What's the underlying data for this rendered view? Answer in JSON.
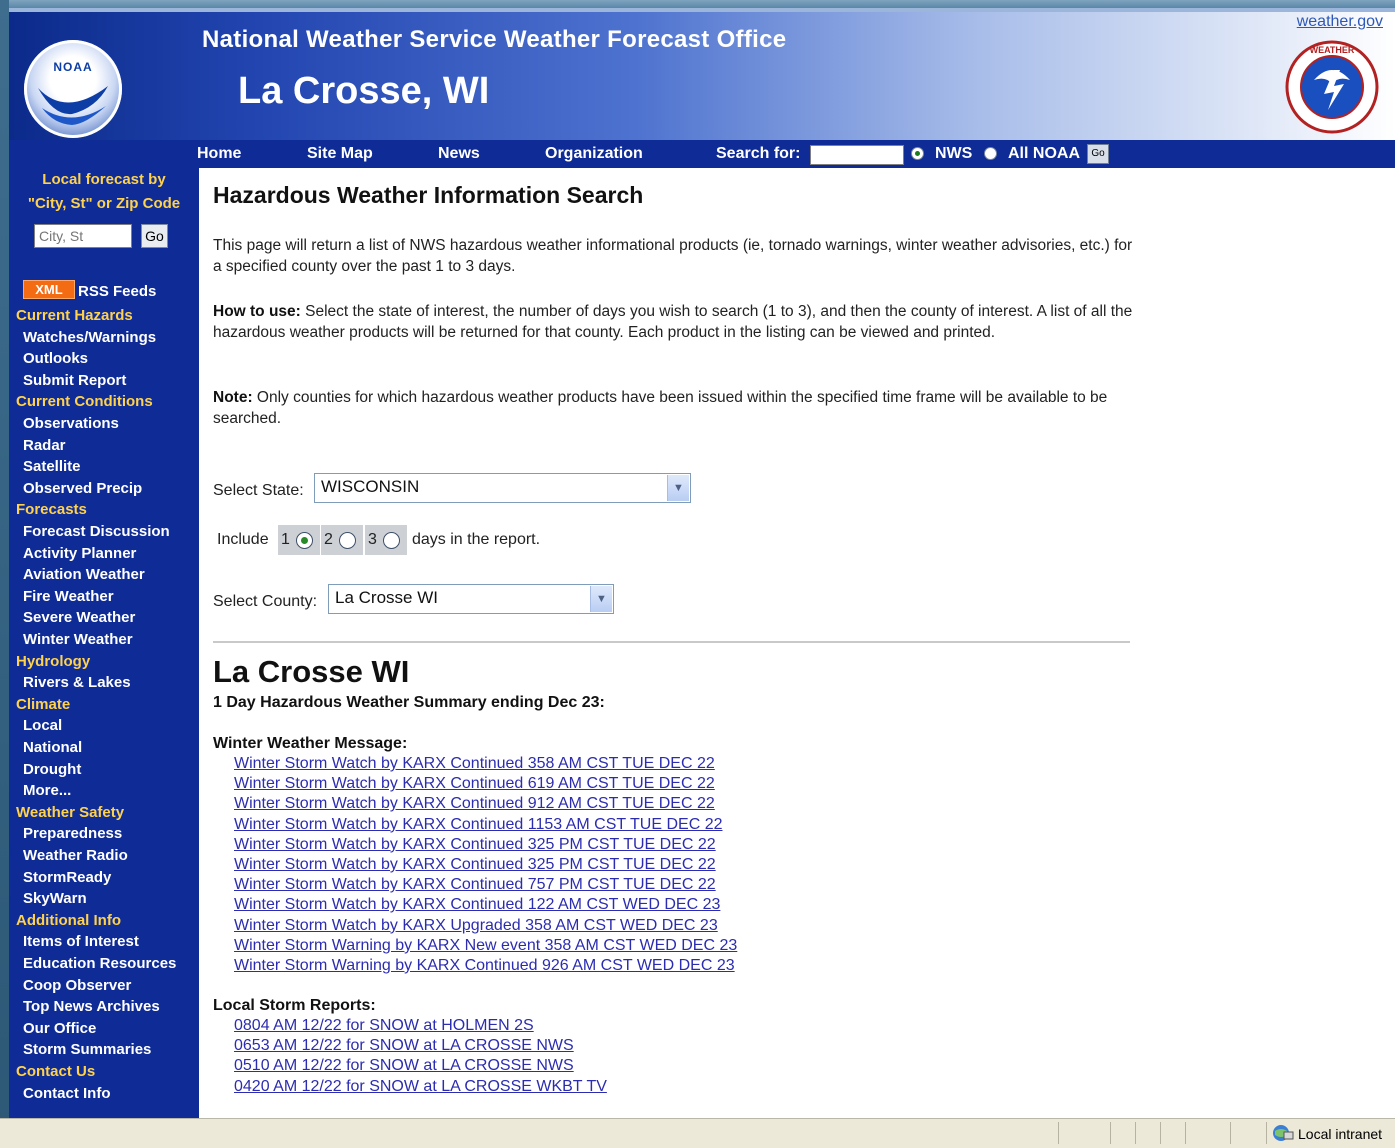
{
  "header": {
    "title": "National Weather Service Weather Forecast Office",
    "office": "La Crosse, WI",
    "weather_gov_link": "weather.gov",
    "noaa_logo_text": "NOAA",
    "nws_logo_text": "NATIONAL WEATHER SERVICE"
  },
  "nav": {
    "items": [
      "Home",
      "Site Map",
      "News",
      "Organization"
    ],
    "search_label": "Search for:",
    "search_value": "",
    "radio_nws": "NWS",
    "radio_noaa": "All NOAA",
    "go_label": "Go"
  },
  "sidebar": {
    "local_forecast_line1": "Local forecast by",
    "local_forecast_line2": "\"City, St\" or Zip Code",
    "city_placeholder": "City, St",
    "go_label": "Go",
    "xml_badge": "XML",
    "rss_label": "RSS Feeds",
    "sections": [
      {
        "heading": "Current Hazards",
        "links": [
          "Watches/Warnings",
          "Outlooks",
          "Submit Report"
        ]
      },
      {
        "heading": "Current Conditions",
        "links": [
          "Observations",
          "Radar",
          "Satellite",
          "Observed Precip"
        ]
      },
      {
        "heading": "Forecasts",
        "links": [
          "Forecast Discussion",
          "Activity Planner",
          "Aviation Weather",
          "Fire Weather",
          "Severe Weather",
          "Winter Weather"
        ]
      },
      {
        "heading": "Hydrology",
        "links": [
          "Rivers & Lakes"
        ]
      },
      {
        "heading": "Climate",
        "links": [
          "Local",
          "National",
          "Drought",
          "More..."
        ]
      },
      {
        "heading": "Weather Safety",
        "links": [
          "Preparedness",
          "Weather Radio",
          "StormReady",
          "SkyWarn"
        ]
      },
      {
        "heading": "Additional Info",
        "links": [
          "Items of Interest",
          "Education Resources",
          "Coop Observer",
          "Top News Archives",
          "Our Office",
          "Storm Summaries"
        ]
      },
      {
        "heading": "Contact Us",
        "links": [
          "Contact Info"
        ]
      }
    ]
  },
  "main": {
    "title": "Hazardous Weather Information Search",
    "intro": "This page will return a list of NWS hazardous weather informational products (ie, tornado warnings, winter weather advisories, etc.) for a specified county over the past 1 to 3 days.",
    "how_to_use_label": "How to use:",
    "how_to_use": " Select the state of interest, the number of days you wish to search (1 to 3), and then the county of interest. A list of all the hazardous weather products will be returned for that county. Each product in the listing can be viewed and printed.",
    "note_label": "Note:",
    "note": " Only counties for which hazardous weather products have been issued within the specified time frame will be available to be searched.",
    "state_label": "Select State:",
    "state_value": "WISCONSIN",
    "include_label": "Include",
    "days": [
      "1",
      "2",
      "3"
    ],
    "selected_day": "1",
    "days_suffix": "days in the report.",
    "county_label": "Select County:",
    "county_value": "La Crosse WI",
    "county_heading": "La Crosse WI",
    "summary": "1 Day Hazardous Weather Summary ending Dec 23:",
    "winter_label": "Winter Weather Message:",
    "winter_links": [
      "Winter Storm Watch by KARX Continued 358 AM CST TUE DEC 22",
      "Winter Storm Watch by KARX Continued 619 AM CST TUE DEC 22",
      "Winter Storm Watch by KARX Continued 912 AM CST TUE DEC 22",
      "Winter Storm Watch by KARX Continued 1153 AM CST TUE DEC 22",
      "Winter Storm Watch by KARX Continued 325 PM CST TUE DEC 22",
      "Winter Storm Watch by KARX Continued 325 PM CST TUE DEC 22",
      "Winter Storm Watch by KARX Continued 757 PM CST TUE DEC 22",
      "Winter Storm Watch by KARX Continued 122 AM CST WED DEC 23",
      "Winter Storm Watch by KARX Upgraded 358 AM CST WED DEC 23",
      "Winter Storm Warning by KARX New event 358 AM CST WED DEC 23",
      "Winter Storm Warning by KARX Continued 926 AM CST WED DEC 23"
    ],
    "lsr_label": "Local Storm Reports:",
    "lsr_links": [
      "0804 AM 12/22 for SNOW at HOLMEN 2S",
      "0653 AM 12/22 for SNOW at LA CROSSE NWS",
      "0510 AM 12/22 for SNOW at LA CROSSE NWS",
      "0420 AM 12/22 for SNOW at LA CROSSE WKBT TV"
    ]
  },
  "statusbar": {
    "zone": "Local intranet"
  },
  "colors": {
    "nav_blue": "#0e2b96",
    "sidebar_heading": "#ffd24d",
    "link": "#2c2cb0"
  }
}
